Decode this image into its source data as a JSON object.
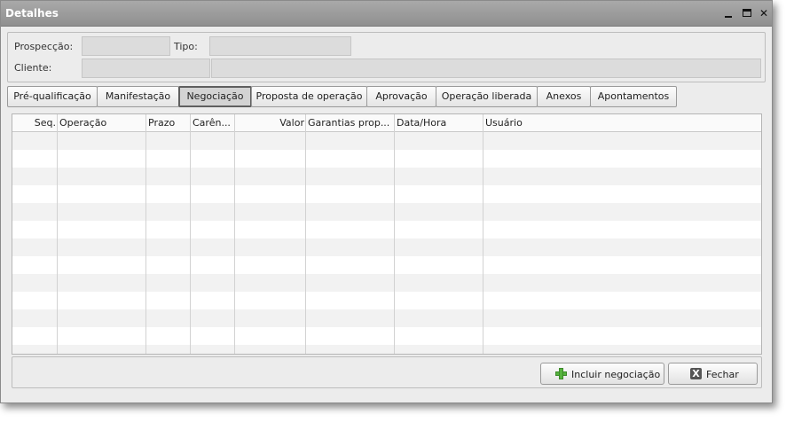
{
  "window": {
    "title": "Detalhes",
    "minimize_glyph": "",
    "close_glyph": "✕"
  },
  "header": {
    "prospeccao_label": "Prospecção:",
    "prospeccao_value": "",
    "tipo_label": "Tipo:",
    "tipo_value": "",
    "cliente_label": "Cliente:",
    "cliente_code": "",
    "cliente_name": ""
  },
  "tabs": [
    {
      "label": "Pré-qualificação",
      "active": false
    },
    {
      "label": "Manifestação",
      "active": false
    },
    {
      "label": "Negociação",
      "active": true
    },
    {
      "label": "Proposta de operação",
      "active": false
    },
    {
      "label": "Aprovação",
      "active": false
    },
    {
      "label": "Operação liberada",
      "active": false
    },
    {
      "label": "Anexos",
      "active": false
    },
    {
      "label": "Apontamentos",
      "active": false
    }
  ],
  "table": {
    "columns": [
      "Seq.",
      "Operação",
      "Prazo",
      "Carên...",
      "Valor",
      "Garantias prop...",
      "Data/Hora",
      "Usuário"
    ],
    "rows": []
  },
  "footer": {
    "include_label": "Incluir negociação",
    "include_icon": "plus-icon",
    "close_label": "Fechar",
    "close_icon": "x-icon"
  },
  "colors": {
    "titlebar": "#999999",
    "accent_green": "#56b33e"
  }
}
